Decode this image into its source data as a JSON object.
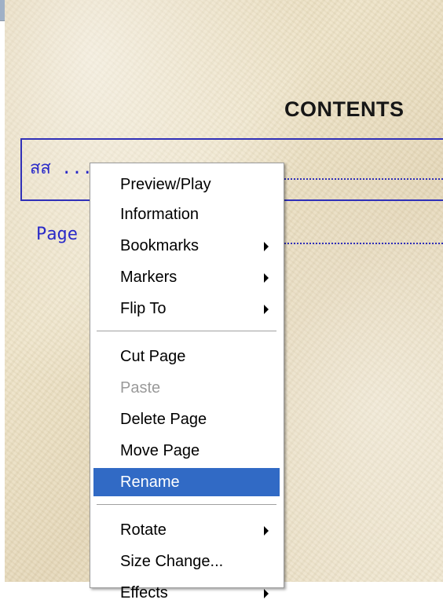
{
  "document": {
    "title": "CONTENTS",
    "entries": [
      {
        "label": "สส ..."
      },
      {
        "label": "Page"
      }
    ]
  },
  "context_menu": {
    "items": [
      {
        "label": "Preview/Play",
        "enabled": true,
        "submenu": false
      },
      {
        "label": "Information",
        "enabled": true,
        "submenu": false
      },
      {
        "label": "Bookmarks",
        "enabled": true,
        "submenu": true
      },
      {
        "label": "Markers",
        "enabled": true,
        "submenu": true
      },
      {
        "label": "Flip To",
        "enabled": true,
        "submenu": true
      },
      {
        "label": "Cut Page",
        "enabled": true,
        "submenu": false
      },
      {
        "label": "Paste",
        "enabled": false,
        "submenu": false
      },
      {
        "label": "Delete Page",
        "enabled": true,
        "submenu": false
      },
      {
        "label": "Move Page",
        "enabled": true,
        "submenu": false
      },
      {
        "label": "Rename",
        "enabled": true,
        "submenu": false,
        "highlighted": true
      },
      {
        "label": "Rotate",
        "enabled": true,
        "submenu": true
      },
      {
        "label": "Size Change...",
        "enabled": true,
        "submenu": false
      },
      {
        "label": "Effects",
        "enabled": true,
        "submenu": true
      }
    ]
  },
  "colors": {
    "highlight": "#316ac5",
    "entry_text": "#2a2ac8",
    "entry_border": "#3030b8"
  }
}
